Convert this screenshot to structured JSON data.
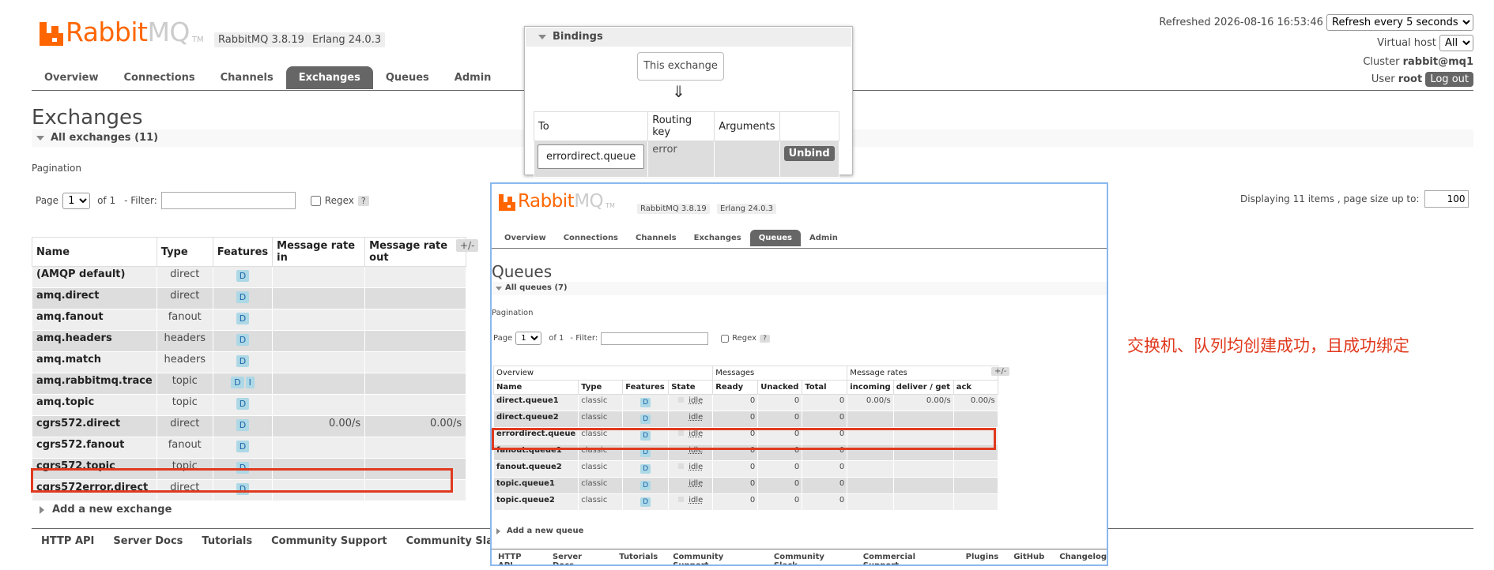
{
  "logo": {
    "rabbit": "Rabbit",
    "mq": "MQ",
    "tm": "TM"
  },
  "versions": {
    "rabbitmq": "RabbitMQ 3.8.19",
    "erlang": "Erlang 24.0.3"
  },
  "nav": [
    {
      "label": "Overview"
    },
    {
      "label": "Connections"
    },
    {
      "label": "Channels"
    },
    {
      "label": "Exchanges",
      "active": true
    },
    {
      "label": "Queues"
    },
    {
      "label": "Admin"
    }
  ],
  "status": {
    "refreshed": "Refreshed 2026-08-16 16:53:46",
    "refresh_option": "Refresh every 5 seconds",
    "vhost_label": "Virtual host",
    "vhost_value": "All",
    "cluster_label": "Cluster",
    "cluster_value": "rabbit@mq1",
    "user_label": "User",
    "user_value": "root",
    "logout": "Log out"
  },
  "page_title": "Exchanges",
  "section_title": "All exchanges (11)",
  "pagination": {
    "heading": "Pagination",
    "page_label": "Page",
    "page_value": "1",
    "of_label": "of 1",
    "filter_label": "- Filter:",
    "filter_value": "",
    "regex_label": "Regex",
    "help": "?",
    "display_label": "Displaying 11 items , page size up to:",
    "page_size": "100"
  },
  "exchanges": {
    "columns": [
      "Name",
      "Type",
      "Features",
      "Message rate in",
      "Message rate out"
    ],
    "plusminus": "+/-",
    "rows": [
      {
        "name": "(AMQP default)",
        "type": "direct",
        "features": [
          "D"
        ],
        "rate_in": "",
        "rate_out": ""
      },
      {
        "name": "amq.direct",
        "type": "direct",
        "features": [
          "D"
        ],
        "rate_in": "",
        "rate_out": ""
      },
      {
        "name": "amq.fanout",
        "type": "fanout",
        "features": [
          "D"
        ],
        "rate_in": "",
        "rate_out": ""
      },
      {
        "name": "amq.headers",
        "type": "headers",
        "features": [
          "D"
        ],
        "rate_in": "",
        "rate_out": ""
      },
      {
        "name": "amq.match",
        "type": "headers",
        "features": [
          "D"
        ],
        "rate_in": "",
        "rate_out": ""
      },
      {
        "name": "amq.rabbitmq.trace",
        "type": "topic",
        "features": [
          "D",
          "I"
        ],
        "rate_in": "",
        "rate_out": ""
      },
      {
        "name": "amq.topic",
        "type": "topic",
        "features": [
          "D"
        ],
        "rate_in": "",
        "rate_out": ""
      },
      {
        "name": "cgrs572.direct",
        "type": "direct",
        "features": [
          "D"
        ],
        "rate_in": "0.00/s",
        "rate_out": "0.00/s"
      },
      {
        "name": "cgrs572.fanout",
        "type": "fanout",
        "features": [
          "D"
        ],
        "rate_in": "",
        "rate_out": ""
      },
      {
        "name": "cgrs572.topic",
        "type": "topic",
        "features": [
          "D"
        ],
        "rate_in": "",
        "rate_out": ""
      },
      {
        "name": "cgrs572error.direct",
        "type": "direct",
        "features": [
          "D"
        ],
        "rate_in": "",
        "rate_out": ""
      }
    ]
  },
  "add_exchange": "Add a new exchange",
  "footer_links": [
    "HTTP API",
    "Server Docs",
    "Tutorials",
    "Community Support",
    "Community Slack"
  ],
  "bindings": {
    "title": "Bindings",
    "this_exchange": "This exchange",
    "arrow": "⇓",
    "columns": [
      "To",
      "Routing key",
      "Arguments",
      ""
    ],
    "row": {
      "to": "errordirect.queue",
      "routing_key": "error",
      "arguments": "",
      "action": "Unbind"
    }
  },
  "queues_shot": {
    "versions": {
      "rabbitmq": "RabbitMQ 3.8.19",
      "erlang": "Erlang 24.0.3"
    },
    "nav": [
      {
        "label": "Overview"
      },
      {
        "label": "Connections"
      },
      {
        "label": "Channels"
      },
      {
        "label": "Exchanges"
      },
      {
        "label": "Queues",
        "active": true
      },
      {
        "label": "Admin"
      }
    ],
    "title": "Queues",
    "section_title": "All queues (7)",
    "pagination": {
      "heading": "Pagination",
      "page_label": "Page",
      "page_value": "1",
      "of_label": "of 1",
      "filter_label": "- Filter:",
      "regex_label": "Regex",
      "help": "?"
    },
    "groups": [
      "Overview",
      "Messages",
      "Message rates"
    ],
    "plusminus": "+/-",
    "columns": [
      "Name",
      "Type",
      "Features",
      "State",
      "Ready",
      "Unacked",
      "Total",
      "incoming",
      "deliver / get",
      "ack"
    ],
    "rows": [
      {
        "name": "direct.queue1",
        "type": "classic",
        "features": "D",
        "state": "idle",
        "ready": "0",
        "unacked": "0",
        "total": "0",
        "incoming": "0.00/s",
        "deliver": "0.00/s",
        "ack": "0.00/s"
      },
      {
        "name": "direct.queue2",
        "type": "classic",
        "features": "D",
        "state": "idle",
        "ready": "0",
        "unacked": "0",
        "total": "0",
        "incoming": "",
        "deliver": "",
        "ack": ""
      },
      {
        "name": "errordirect.queue",
        "type": "classic",
        "features": "D",
        "state": "idle",
        "ready": "0",
        "unacked": "0",
        "total": "0",
        "incoming": "",
        "deliver": "",
        "ack": ""
      },
      {
        "name": "fanout.queue1",
        "type": "classic",
        "features": "D",
        "state": "idle",
        "ready": "0",
        "unacked": "0",
        "total": "0",
        "incoming": "",
        "deliver": "",
        "ack": ""
      },
      {
        "name": "fanout.queue2",
        "type": "classic",
        "features": "D",
        "state": "idle",
        "ready": "0",
        "unacked": "0",
        "total": "0",
        "incoming": "",
        "deliver": "",
        "ack": ""
      },
      {
        "name": "topic.queue1",
        "type": "classic",
        "features": "D",
        "state": "idle",
        "ready": "0",
        "unacked": "0",
        "total": "0",
        "incoming": "",
        "deliver": "",
        "ack": ""
      },
      {
        "name": "topic.queue2",
        "type": "classic",
        "features": "D",
        "state": "idle",
        "ready": "0",
        "unacked": "0",
        "total": "0",
        "incoming": "",
        "deliver": "",
        "ack": ""
      }
    ],
    "add_queue": "Add a new queue",
    "footer_links": [
      "HTTP API",
      "Server Docs",
      "Tutorials",
      "Community Support",
      "Community Slack",
      "Commercial Support",
      "Plugins",
      "GitHub",
      "Changelog"
    ]
  },
  "annotation": "交换机、队列均创建成功，且成功绑定",
  "colors": {
    "brand": "#ff6600",
    "highlight": "#e03a1e",
    "nav_active": "#666666",
    "badge": "#add8e6"
  }
}
